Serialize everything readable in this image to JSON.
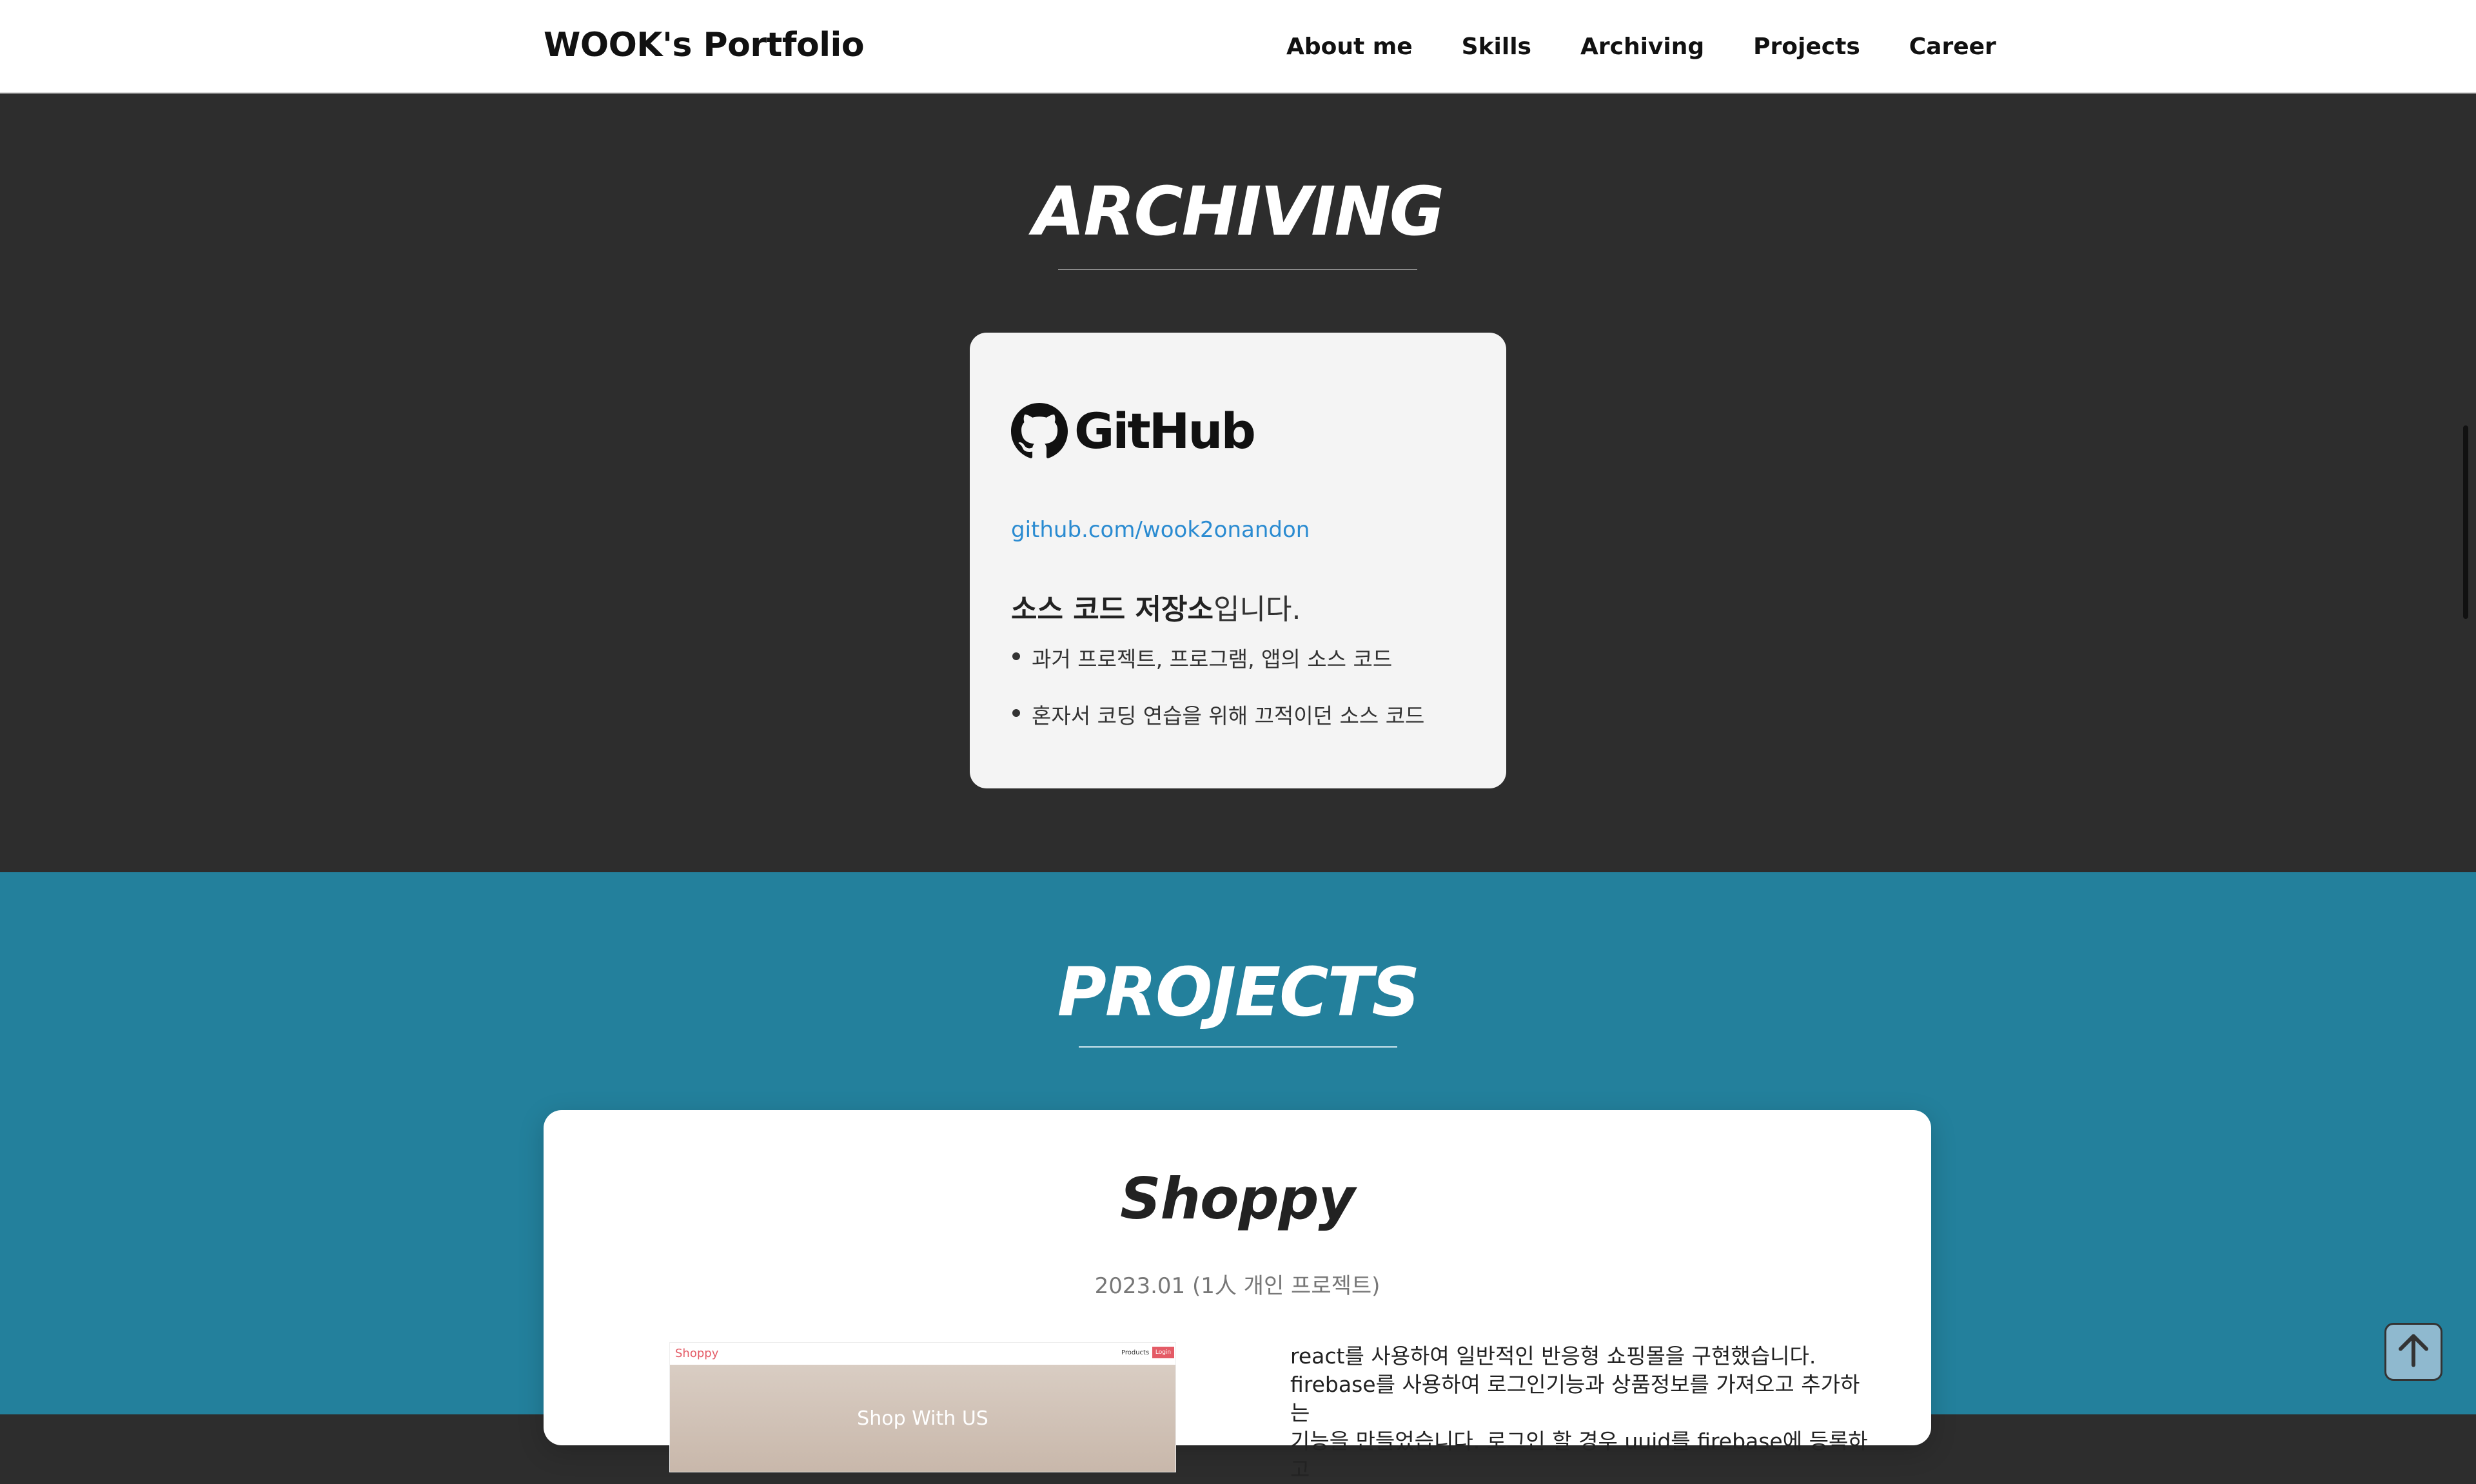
{
  "header": {
    "brand": "WOOK's Portfolio",
    "nav": [
      "About me",
      "Skills",
      "Archiving",
      "Projects",
      "Career"
    ]
  },
  "archiving": {
    "title": "ARCHIVING",
    "card": {
      "logo_text": "GitHub",
      "logo_icon": "github-octocat-icon",
      "link": "github.com/wook2onandon",
      "desc_bold": "소스 코드 저장소",
      "desc_rest": "입니다.",
      "items": [
        "과거 프로젝트, 프로그램, 앱의 소스 코드",
        "혼자서 코딩 연습을 위해 끄적이던 소스 코드"
      ]
    }
  },
  "projects": {
    "title": "PROJECTS",
    "card": {
      "name": "Shoppy",
      "date": "2023.01 (1人 개인 프로젝트)",
      "screenshot": {
        "logo": "Shoppy",
        "nav_products": "Products",
        "nav_login": "Login",
        "hero_text": "Shop With US"
      },
      "description": [
        "react를 사용하여 일반적인 반응형 쇼핑몰을 구현했습니다.",
        "firebase를 사용하여 로그인기능과 상품정보를 가져오고 추가하는",
        "기능을 만들었습니다. 로그인 할 경우 uuid를 firebase에 등록하고"
      ]
    }
  },
  "colors": {
    "archiving_bg": "#2d2d2d",
    "projects_bg": "#23809c",
    "link": "#2a8bd1",
    "scroll_btn": "#8fb9cf"
  },
  "icons": {
    "scroll_top": "arrow-up-icon"
  }
}
